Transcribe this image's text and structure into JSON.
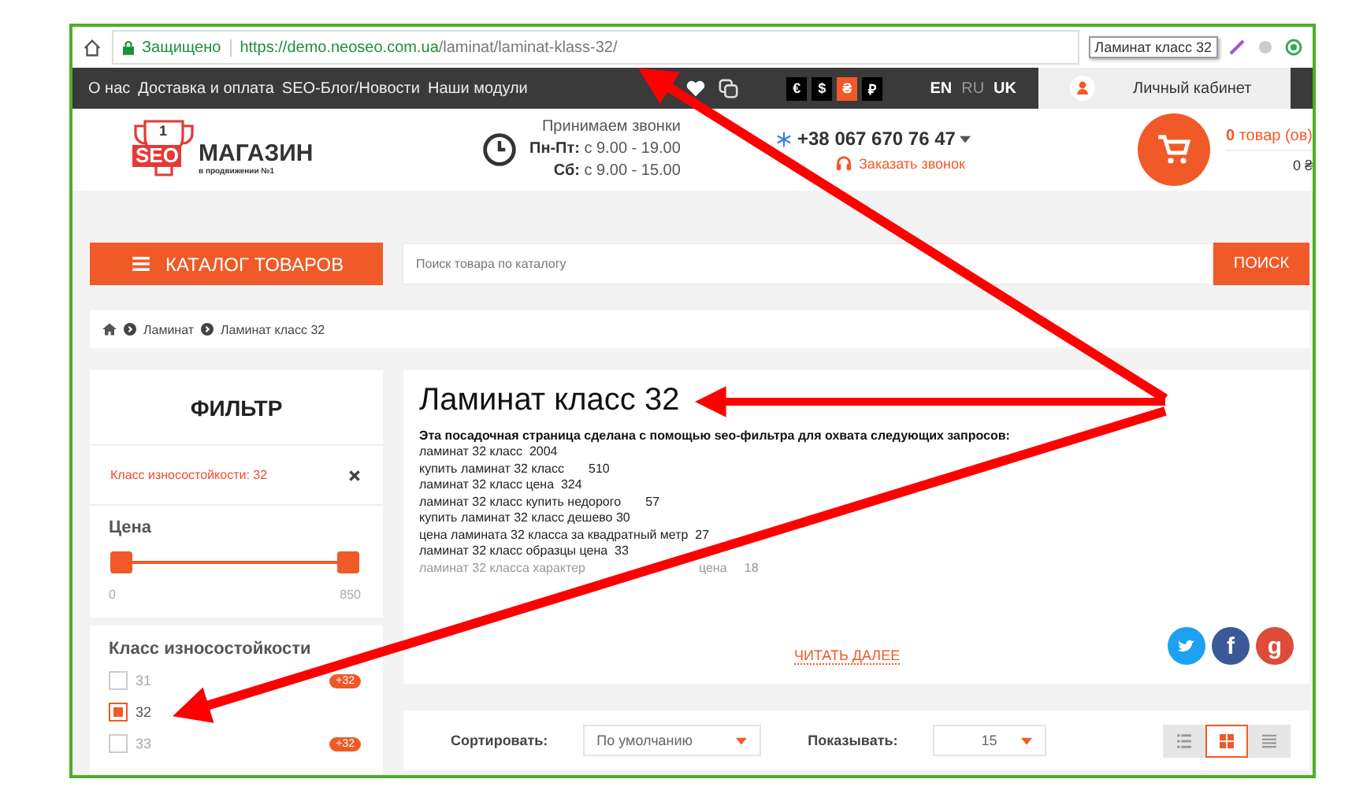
{
  "browser": {
    "secure_label": "Защищено",
    "url_host": "https://demo.neoseo.com.ua",
    "url_path": "/laminat/laminat-klass-32/",
    "tooltip": "Ламинат класс 32"
  },
  "topbar": {
    "links": [
      "О нас",
      "Доставка и оплата",
      "SEO-Блог/Новости",
      "Наши модули"
    ],
    "currencies": [
      {
        "symbol": "€",
        "selected": false
      },
      {
        "symbol": "$",
        "selected": false
      },
      {
        "symbol": "₴",
        "selected": true
      },
      {
        "symbol": "₽",
        "selected": false
      }
    ],
    "languages": [
      {
        "code": "EN",
        "selected": false
      },
      {
        "code": "RU",
        "selected": true
      },
      {
        "code": "UK",
        "selected": false
      }
    ],
    "account": "Личный кабинет"
  },
  "header": {
    "logo": {
      "cup_number": "1",
      "seo": "SEO",
      "name": "МАГАЗИН",
      "tagline": "в продвижении №1"
    },
    "hours": {
      "title": "Принимаем звонки",
      "lines": [
        {
          "label": "Пн-Пт:",
          "value": "с 9.00 - 19.00"
        },
        {
          "label": "Сб:",
          "value": "с 9.00 - 15.00"
        }
      ]
    },
    "phone": "+38 067 670 76 47",
    "callback": "Заказать звонок",
    "cart": {
      "count": "0",
      "count_label": "товар (ов)",
      "total": "0 ₴"
    }
  },
  "catalog_button": "КАТАЛОГ ТОВАРОВ",
  "search": {
    "placeholder": "Поиск товара по каталогу",
    "button": "ПОИСК"
  },
  "breadcrumbs": [
    "Ламинат",
    "Ламинат класс 32"
  ],
  "filter": {
    "title": "ФИЛЬТР",
    "active": "Класс износостойкости: 32",
    "price": {
      "title": "Цена",
      "thumbs": [
        {
          "level": 0
        },
        {
          "level": 1
        }
      ],
      "min": "0",
      "max": "850"
    },
    "class": {
      "title": "Класс износостойкости",
      "options": [
        {
          "label": "31",
          "checked": false,
          "badge": "+32"
        },
        {
          "label": "32",
          "checked": true
        },
        {
          "label": "33",
          "checked": false,
          "badge": "+32"
        }
      ]
    }
  },
  "content": {
    "title": "Ламинат класс 32",
    "intro": "Эта посадочная страница сделана с помощью seo-фильтра для охвата следующих запросов:",
    "queries": [
      {
        "text": "ламинат 32 класс  2004",
        "faded": false
      },
      {
        "text": "купить ламинат 32 класс       510",
        "faded": false
      },
      {
        "text": "ламинат 32 класс цена  324",
        "faded": false
      },
      {
        "text": "ламинат 32 класс купить недорого       57",
        "faded": false
      },
      {
        "text": "купить ламинат 32 класс дешево 30",
        "faded": false
      },
      {
        "text": "цена ламината 32 класса за квадратный метр  27",
        "faded": false
      },
      {
        "text": "ламинат 32 класс образцы цена  33",
        "faded": false
      },
      {
        "text": "ламинат 32 класса характер",
        "tail": "цена     18",
        "faded": true
      }
    ],
    "read_more": "ЧИТАТЬ ДАЛЕЕ",
    "social": [
      {
        "kind": "twitter"
      },
      {
        "kind": "facebook",
        "glyph": "f"
      },
      {
        "kind": "google",
        "glyph": "g"
      }
    ]
  },
  "toolbar": {
    "sort_label": "Сортировать:",
    "sort_value": "По умолчанию",
    "show_label": "Показывать:",
    "show_value": "15",
    "views": [
      {
        "kind": "list",
        "selected": false
      },
      {
        "kind": "grid",
        "selected": true
      },
      {
        "kind": "compact",
        "selected": false
      }
    ]
  }
}
